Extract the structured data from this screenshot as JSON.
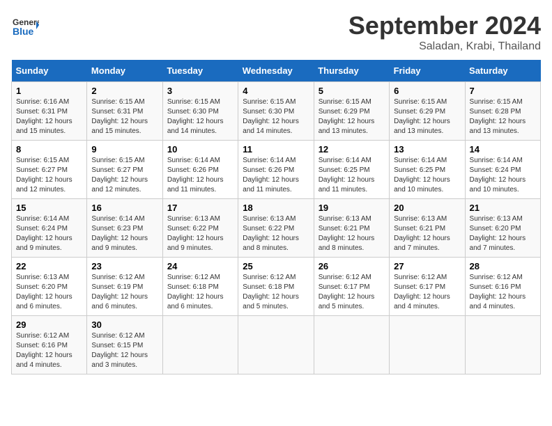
{
  "header": {
    "logo_line1": "General",
    "logo_line2": "Blue",
    "month": "September 2024",
    "location": "Saladan, Krabi, Thailand"
  },
  "days_of_week": [
    "Sunday",
    "Monday",
    "Tuesday",
    "Wednesday",
    "Thursday",
    "Friday",
    "Saturday"
  ],
  "weeks": [
    [
      {
        "day": "1",
        "info": "Sunrise: 6:16 AM\nSunset: 6:31 PM\nDaylight: 12 hours\nand 15 minutes."
      },
      {
        "day": "2",
        "info": "Sunrise: 6:15 AM\nSunset: 6:31 PM\nDaylight: 12 hours\nand 15 minutes."
      },
      {
        "day": "3",
        "info": "Sunrise: 6:15 AM\nSunset: 6:30 PM\nDaylight: 12 hours\nand 14 minutes."
      },
      {
        "day": "4",
        "info": "Sunrise: 6:15 AM\nSunset: 6:30 PM\nDaylight: 12 hours\nand 14 minutes."
      },
      {
        "day": "5",
        "info": "Sunrise: 6:15 AM\nSunset: 6:29 PM\nDaylight: 12 hours\nand 13 minutes."
      },
      {
        "day": "6",
        "info": "Sunrise: 6:15 AM\nSunset: 6:29 PM\nDaylight: 12 hours\nand 13 minutes."
      },
      {
        "day": "7",
        "info": "Sunrise: 6:15 AM\nSunset: 6:28 PM\nDaylight: 12 hours\nand 13 minutes."
      }
    ],
    [
      {
        "day": "8",
        "info": "Sunrise: 6:15 AM\nSunset: 6:27 PM\nDaylight: 12 hours\nand 12 minutes."
      },
      {
        "day": "9",
        "info": "Sunrise: 6:15 AM\nSunset: 6:27 PM\nDaylight: 12 hours\nand 12 minutes."
      },
      {
        "day": "10",
        "info": "Sunrise: 6:14 AM\nSunset: 6:26 PM\nDaylight: 12 hours\nand 11 minutes."
      },
      {
        "day": "11",
        "info": "Sunrise: 6:14 AM\nSunset: 6:26 PM\nDaylight: 12 hours\nand 11 minutes."
      },
      {
        "day": "12",
        "info": "Sunrise: 6:14 AM\nSunset: 6:25 PM\nDaylight: 12 hours\nand 11 minutes."
      },
      {
        "day": "13",
        "info": "Sunrise: 6:14 AM\nSunset: 6:25 PM\nDaylight: 12 hours\nand 10 minutes."
      },
      {
        "day": "14",
        "info": "Sunrise: 6:14 AM\nSunset: 6:24 PM\nDaylight: 12 hours\nand 10 minutes."
      }
    ],
    [
      {
        "day": "15",
        "info": "Sunrise: 6:14 AM\nSunset: 6:24 PM\nDaylight: 12 hours\nand 9 minutes."
      },
      {
        "day": "16",
        "info": "Sunrise: 6:14 AM\nSunset: 6:23 PM\nDaylight: 12 hours\nand 9 minutes."
      },
      {
        "day": "17",
        "info": "Sunrise: 6:13 AM\nSunset: 6:22 PM\nDaylight: 12 hours\nand 9 minutes."
      },
      {
        "day": "18",
        "info": "Sunrise: 6:13 AM\nSunset: 6:22 PM\nDaylight: 12 hours\nand 8 minutes."
      },
      {
        "day": "19",
        "info": "Sunrise: 6:13 AM\nSunset: 6:21 PM\nDaylight: 12 hours\nand 8 minutes."
      },
      {
        "day": "20",
        "info": "Sunrise: 6:13 AM\nSunset: 6:21 PM\nDaylight: 12 hours\nand 7 minutes."
      },
      {
        "day": "21",
        "info": "Sunrise: 6:13 AM\nSunset: 6:20 PM\nDaylight: 12 hours\nand 7 minutes."
      }
    ],
    [
      {
        "day": "22",
        "info": "Sunrise: 6:13 AM\nSunset: 6:20 PM\nDaylight: 12 hours\nand 6 minutes."
      },
      {
        "day": "23",
        "info": "Sunrise: 6:12 AM\nSunset: 6:19 PM\nDaylight: 12 hours\nand 6 minutes."
      },
      {
        "day": "24",
        "info": "Sunrise: 6:12 AM\nSunset: 6:18 PM\nDaylight: 12 hours\nand 6 minutes."
      },
      {
        "day": "25",
        "info": "Sunrise: 6:12 AM\nSunset: 6:18 PM\nDaylight: 12 hours\nand 5 minutes."
      },
      {
        "day": "26",
        "info": "Sunrise: 6:12 AM\nSunset: 6:17 PM\nDaylight: 12 hours\nand 5 minutes."
      },
      {
        "day": "27",
        "info": "Sunrise: 6:12 AM\nSunset: 6:17 PM\nDaylight: 12 hours\nand 4 minutes."
      },
      {
        "day": "28",
        "info": "Sunrise: 6:12 AM\nSunset: 6:16 PM\nDaylight: 12 hours\nand 4 minutes."
      }
    ],
    [
      {
        "day": "29",
        "info": "Sunrise: 6:12 AM\nSunset: 6:16 PM\nDaylight: 12 hours\nand 4 minutes."
      },
      {
        "day": "30",
        "info": "Sunrise: 6:12 AM\nSunset: 6:15 PM\nDaylight: 12 hours\nand 3 minutes."
      },
      {
        "day": "",
        "info": ""
      },
      {
        "day": "",
        "info": ""
      },
      {
        "day": "",
        "info": ""
      },
      {
        "day": "",
        "info": ""
      },
      {
        "day": "",
        "info": ""
      }
    ]
  ]
}
